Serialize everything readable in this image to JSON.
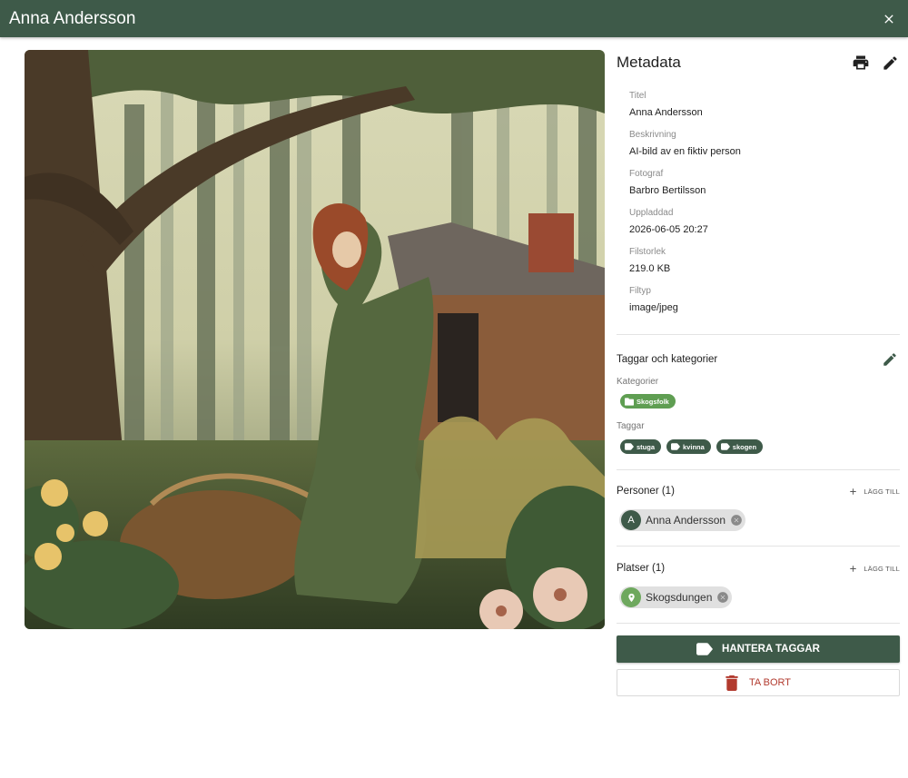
{
  "window": {
    "title": "Anna Andersson"
  },
  "metadata": {
    "heading": "Metadata",
    "fields": [
      {
        "label": "Titel",
        "value": "Anna Andersson"
      },
      {
        "label": "Beskrivning",
        "value": "AI-bild av en fiktiv person"
      },
      {
        "label": "Fotograf",
        "value": "Barbro Bertilsson"
      },
      {
        "label": "Uppladdad",
        "value": "2026-06-05 20:27"
      },
      {
        "label": "Filstorlek",
        "value": "219.0 KB"
      },
      {
        "label": "Filtyp",
        "value": "image/jpeg"
      }
    ]
  },
  "tags": {
    "heading": "Taggar och kategorier",
    "categories_label": "Kategorier",
    "categories": [
      "Skogsfolk"
    ],
    "tags_label": "Taggar",
    "tags": [
      "stuga",
      "kvinna",
      "skogen"
    ]
  },
  "persons": {
    "heading": "Personer (1)",
    "add_label": "LÄGG TILL",
    "items": [
      {
        "initial": "A",
        "name": "Anna Andersson"
      }
    ]
  },
  "places": {
    "heading": "Platser (1)",
    "add_label": "LÄGG TILL",
    "items": [
      {
        "name": "Skogsdungen"
      }
    ]
  },
  "actions": {
    "manage_tags": "HANTERA TAGGAR",
    "delete": "TA BORT"
  },
  "colors": {
    "primary": "#3e5a49",
    "category_chip": "#5f9e52",
    "danger": "#b23a2e"
  }
}
